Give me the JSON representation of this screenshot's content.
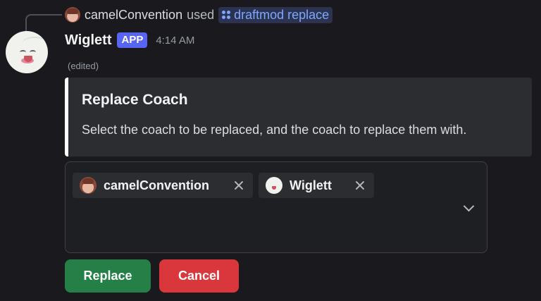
{
  "command_line": {
    "user": "camelConvention",
    "used_text": "used",
    "command": "draftmod replace"
  },
  "message": {
    "author": "Wiglett",
    "badge": "APP",
    "timestamp": "4:14 AM",
    "edited": "(edited)"
  },
  "embed": {
    "title": "Replace Coach",
    "description": "Select the coach to be replaced, and the coach to replace them with.",
    "accent_color": "#ffffff"
  },
  "select": {
    "selected": [
      {
        "label": "camelConvention",
        "avatar": "camelConvention-avatar"
      },
      {
        "label": "Wiglett",
        "avatar": "wiglett-avatar"
      }
    ]
  },
  "buttons": {
    "replace": {
      "label": "Replace",
      "color": "#248046"
    },
    "cancel": {
      "label": "Cancel",
      "color": "#da373c"
    }
  },
  "colors": {
    "background": "#1a1a1e",
    "brand": "#5865f2",
    "link": "#7ea6ff"
  }
}
